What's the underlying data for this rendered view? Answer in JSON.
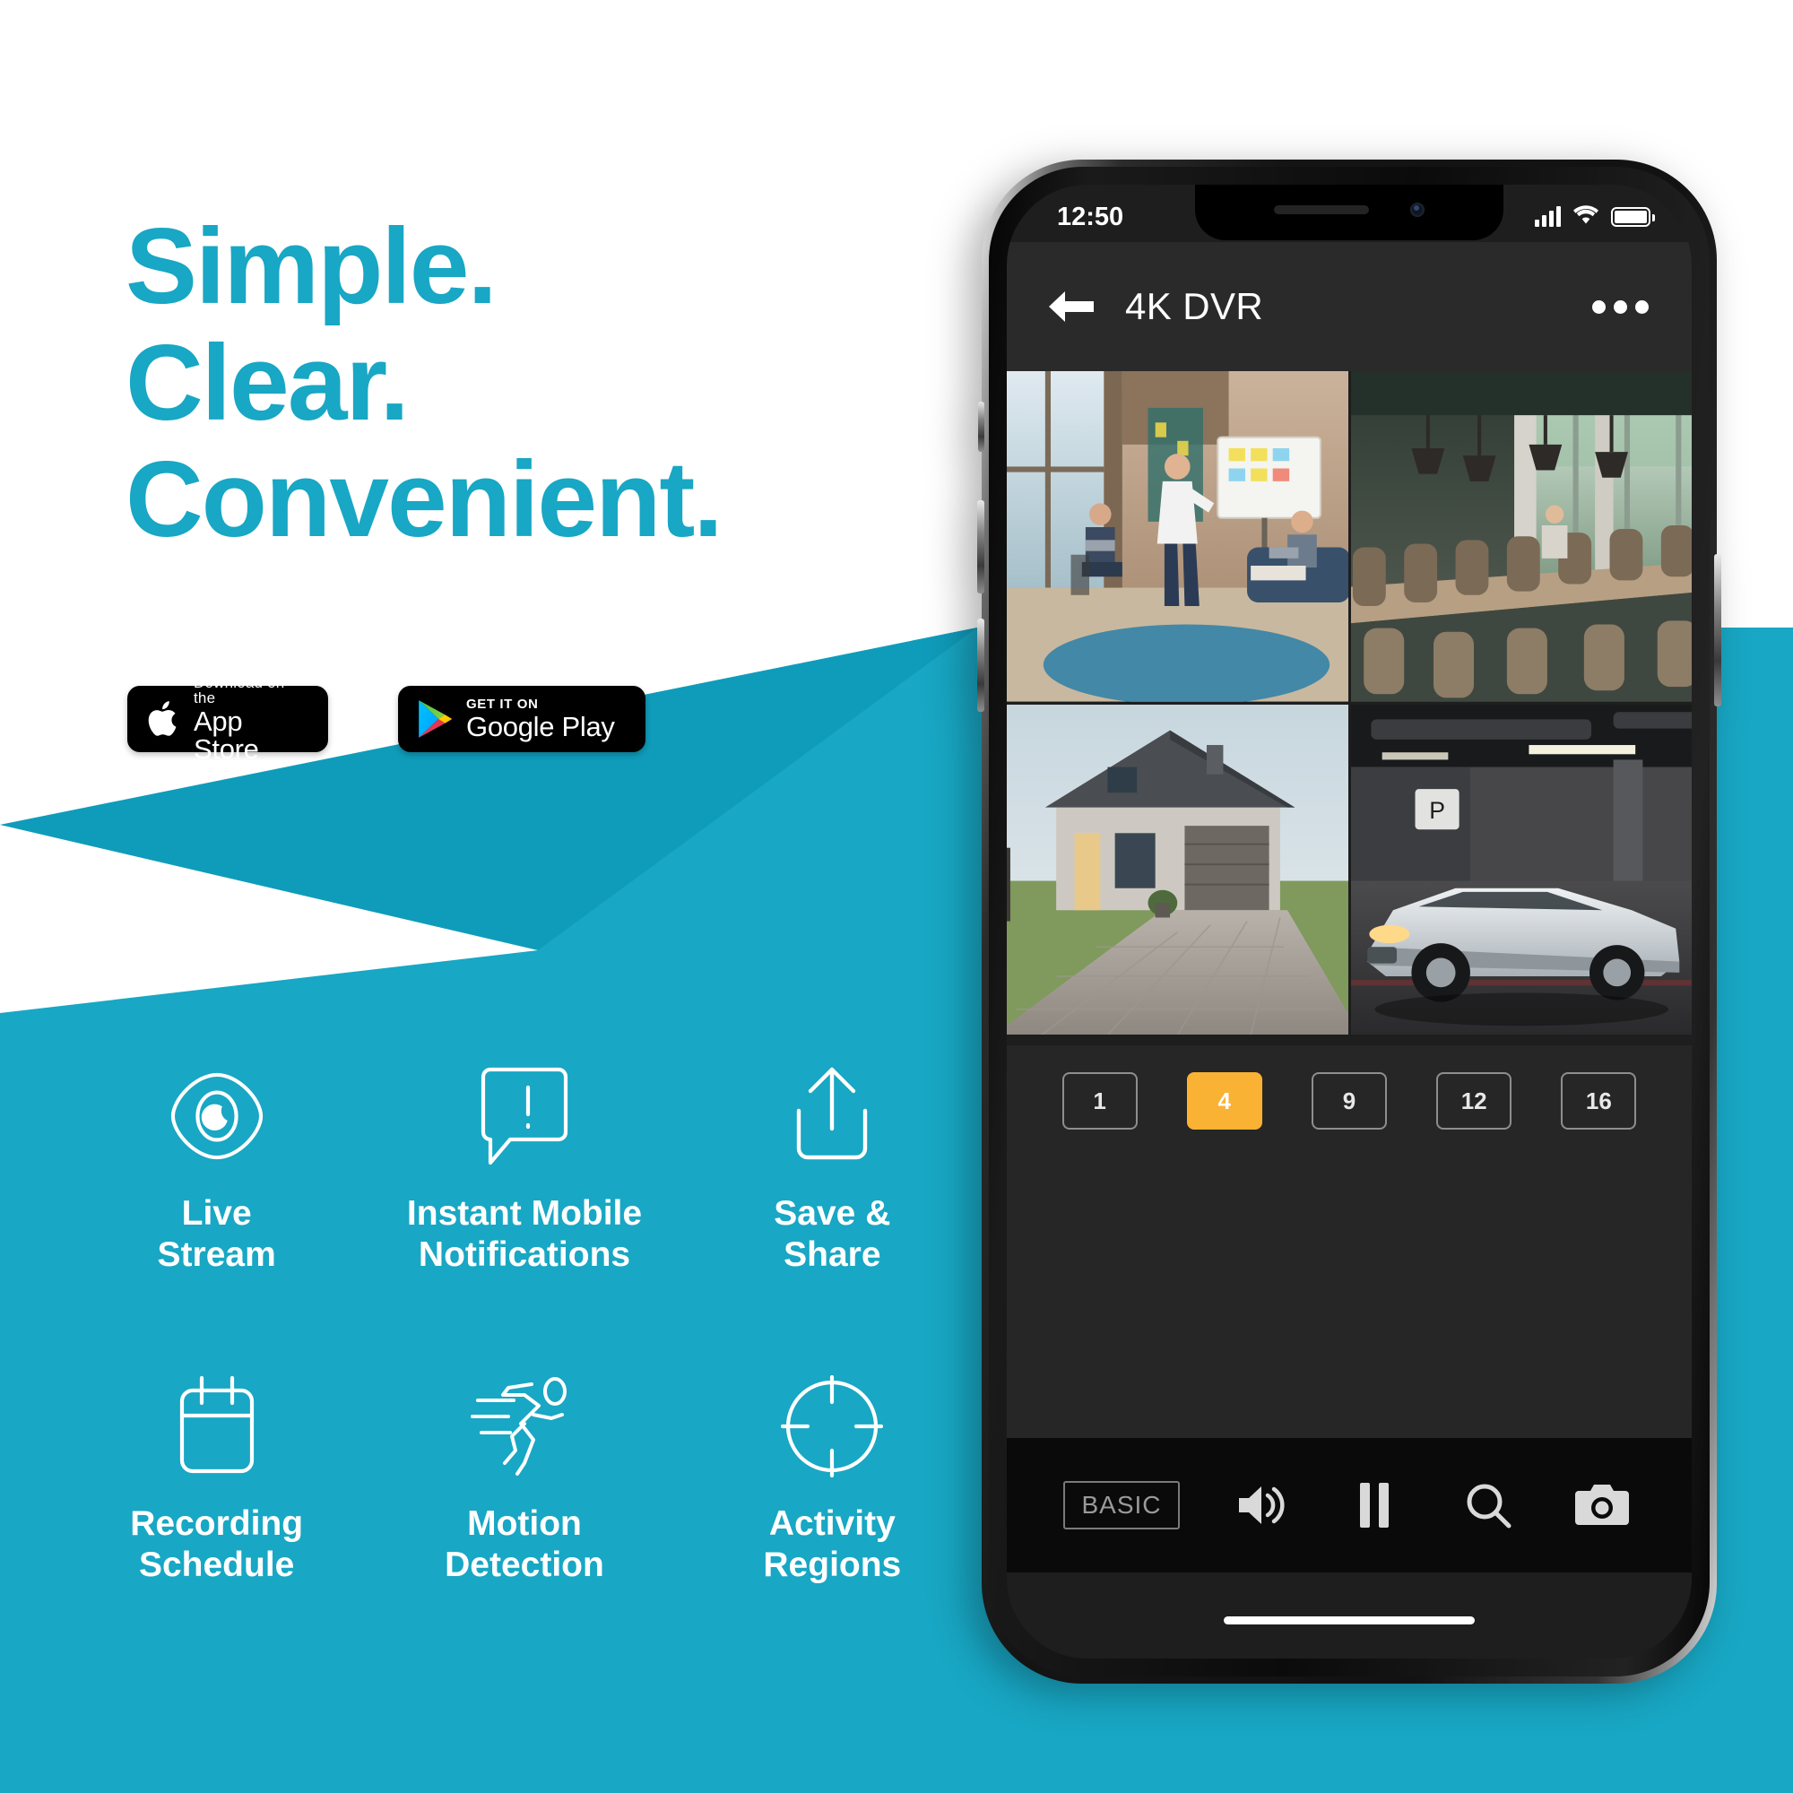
{
  "brand": {
    "accent": "#18a7c4",
    "accent_dark": "#0c94b0",
    "white": "#ffffff",
    "highlight": "#f9b233"
  },
  "headline": {
    "lines": [
      "Simple.",
      "Clear.",
      "Convenient."
    ]
  },
  "store_badges": [
    {
      "id": "app-store",
      "icon": "apple-logo-icon",
      "small_text": "Download on the",
      "big_text": "App Store"
    },
    {
      "id": "google-play",
      "icon": "google-play-icon",
      "small_text": "GET IT ON",
      "big_text": "Google Play"
    }
  ],
  "features": [
    {
      "icon": "eye-icon",
      "label": "Live\nStream"
    },
    {
      "icon": "alert-bubble-icon",
      "label": "Instant Mobile\nNotifications"
    },
    {
      "icon": "share-upload-icon",
      "label": "Save &\nShare"
    },
    {
      "icon": "calendar-icon",
      "label": "Recording\nSchedule"
    },
    {
      "icon": "running-person-icon",
      "label": "Motion\nDetection"
    },
    {
      "icon": "crosshair-icon",
      "label": "Activity\nRegions"
    }
  ],
  "phone": {
    "status_bar": {
      "time": "12:50",
      "signal_icon": "cellular-signal-icon",
      "wifi_icon": "wifi-icon",
      "battery_icon": "battery-full-icon"
    },
    "nav_bar": {
      "back_icon": "arrow-left-icon",
      "title": "4K DVR",
      "more_icon": "more-horizontal-icon"
    },
    "camera_feeds": [
      {
        "id": "cam-1",
        "scene": "office-meeting"
      },
      {
        "id": "cam-2",
        "scene": "restaurant-interior"
      },
      {
        "id": "cam-3",
        "scene": "house-driveway"
      },
      {
        "id": "cam-4",
        "scene": "parking-garage-car"
      }
    ],
    "channel_buttons": [
      {
        "label": "1",
        "active": false
      },
      {
        "label": "4",
        "active": true
      },
      {
        "label": "9",
        "active": false
      },
      {
        "label": "12",
        "active": false
      },
      {
        "label": "16",
        "active": false
      }
    ],
    "toolbar": [
      {
        "id": "mode",
        "label": "BASIC",
        "icon": "basic-mode-badge"
      },
      {
        "id": "volume",
        "label": "",
        "icon": "speaker-volume-icon"
      },
      {
        "id": "pause",
        "label": "",
        "icon": "pause-icon"
      },
      {
        "id": "search",
        "label": "",
        "icon": "search-icon"
      },
      {
        "id": "snapshot",
        "label": "",
        "icon": "camera-icon"
      }
    ]
  }
}
